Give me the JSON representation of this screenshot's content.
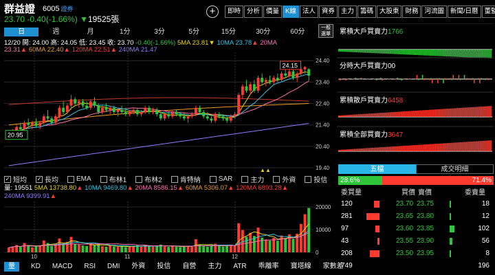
{
  "header": {
    "name": "群益證",
    "code": "6005",
    "code_tag": "證券",
    "price": "23.70",
    "change": "-0.40(-1.66%)",
    "volume": "19525張",
    "plus_label": "+"
  },
  "topnav": [
    "即時",
    "分析",
    "價量",
    "K線",
    "法人",
    "資券",
    "主力",
    "籌碼",
    "大股東",
    "財務",
    "河流圖",
    "新聞/日曆",
    "董監/公司"
  ],
  "topnav_active": "K線",
  "periods": [
    "日",
    "週",
    "月",
    "1分",
    "3分",
    "5分",
    "15分",
    "30分",
    "60分"
  ],
  "periods_active": "日",
  "side_button": "一般\n選單",
  "kline_info": {
    "date": "12/20",
    "open": "開: 24.00",
    "high": "高: 24.05",
    "low": "低: 23.45",
    "close": "收: 23.70",
    "change": "-0.40(-1.66%)",
    "ma5": "5MA 23.81",
    "ma10": "10MA 23.78",
    "ma20_label": "20MA",
    "ma20": "23.31",
    "ma60": "60MA 22.40",
    "ma120": "120MA 22.51",
    "ma240": "240MA 21.47"
  },
  "price_axis": [
    "24.40",
    "23.40",
    "22.40",
    "21.40",
    "20.40",
    "19.40"
  ],
  "price_callouts": {
    "high": "24.15",
    "low": "20.95"
  },
  "toggles": [
    {
      "label": "短均",
      "checked": true
    },
    {
      "label": "長均",
      "checked": true
    },
    {
      "label": "EMA",
      "checked": false
    },
    {
      "label": "布林1",
      "checked": false
    },
    {
      "label": "布林2",
      "checked": false
    },
    {
      "label": "肯特納",
      "checked": false
    },
    {
      "label": "SAR",
      "checked": false
    },
    {
      "label": "主力",
      "checked": false
    },
    {
      "label": "外資",
      "checked": false
    },
    {
      "label": "投信",
      "checked": false
    }
  ],
  "volume_info": {
    "vol": "量: 19551",
    "ma5": "5MA 13738.80",
    "ma10": "10MA 9469.80",
    "ma20": "20MA 8586.15",
    "ma60": "60MA 5306.07",
    "ma120": "120MA 6893.28",
    "ma240": "240MA 9399.91"
  },
  "volume_axis": [
    "20000",
    "10000",
    "0"
  ],
  "month_labels": [
    "10",
    "11",
    "12"
  ],
  "bottom_tabs": [
    "量",
    "KD",
    "MACD",
    "RSI",
    "DMI",
    "外資",
    "投信",
    "自營",
    "主力",
    "ATR",
    "乖離率",
    "寶塔線",
    "家數差"
  ],
  "bottom_active": "量",
  "right_panels": [
    {
      "label": "累積大戶買賣力",
      "value": "1766",
      "color": "#2ec53a"
    },
    {
      "label": "分時大戶買賣力",
      "value": "00",
      "color": "#ffffff"
    },
    {
      "label": "累積散戶買賣力",
      "value": "6458",
      "color": "#ff3b30"
    },
    {
      "label": "累積全部買賣力",
      "value": "3647",
      "color": "#ff3b30"
    }
  ],
  "orderbook_tabs": [
    "五檔",
    "成交明細"
  ],
  "ratio": {
    "buy": "28.6%",
    "sell": "71.4%"
  },
  "orderbook_headers": {
    "buy_qty": "委買量",
    "buy_price": "買價",
    "sell_price": "賣價",
    "sell_qty": "委賣量"
  },
  "orderbook": [
    {
      "buy_qty": "120",
      "buy_price": "23.70",
      "sell_price": "23.75",
      "sell_qty": "18"
    },
    {
      "buy_qty": "281",
      "buy_price": "23.65",
      "sell_price": "23.80",
      "sell_qty": "12"
    },
    {
      "buy_qty": "97",
      "buy_price": "23.60",
      "sell_price": "23.85",
      "sell_qty": "102"
    },
    {
      "buy_qty": "43",
      "buy_price": "23.55",
      "sell_price": "23.90",
      "sell_qty": "56"
    },
    {
      "buy_qty": "208",
      "buy_price": "23.50",
      "sell_price": "23.95",
      "sell_qty": "8"
    }
  ],
  "orderbook_total": {
    "buy": "749",
    "sell": "196"
  },
  "colors": {
    "up": "#ff3b30",
    "down": "#2ec53a",
    "accent": "#1e8fd0",
    "cyan": "#29b6e6"
  },
  "chart_data": {
    "type": "candlestick",
    "ylim": [
      19.4,
      24.6
    ],
    "candles": [
      [
        20.8,
        21.0,
        20.7,
        20.95
      ],
      [
        20.95,
        21.2,
        20.9,
        21.1
      ],
      [
        21.1,
        21.4,
        21.0,
        21.3
      ],
      [
        21.3,
        21.5,
        21.1,
        21.2
      ],
      [
        21.2,
        21.6,
        21.1,
        21.5
      ],
      [
        21.5,
        21.7,
        21.3,
        21.4
      ],
      [
        21.4,
        21.6,
        21.2,
        21.5
      ],
      [
        21.5,
        21.7,
        21.3,
        21.35
      ],
      [
        21.35,
        21.6,
        21.2,
        21.5
      ],
      [
        21.5,
        21.9,
        21.4,
        21.8
      ],
      [
        21.8,
        22.1,
        21.6,
        21.7
      ],
      [
        21.7,
        21.8,
        21.4,
        21.5
      ],
      [
        21.5,
        21.9,
        21.4,
        21.8
      ],
      [
        21.8,
        22.3,
        21.7,
        22.2
      ],
      [
        22.2,
        22.5,
        21.9,
        22.0
      ],
      [
        22.0,
        22.4,
        21.9,
        22.3
      ],
      [
        22.3,
        22.8,
        22.1,
        22.6
      ],
      [
        22.6,
        22.7,
        22.3,
        22.4
      ],
      [
        22.4,
        22.6,
        22.2,
        22.5
      ],
      [
        22.5,
        22.6,
        22.2,
        22.3
      ],
      [
        22.3,
        22.5,
        22.1,
        22.2
      ],
      [
        22.2,
        22.6,
        22.1,
        22.5
      ],
      [
        22.5,
        22.7,
        22.2,
        22.3
      ],
      [
        22.3,
        22.4,
        21.9,
        22.0
      ],
      [
        22.0,
        22.3,
        21.9,
        22.2
      ],
      [
        22.2,
        22.4,
        22.0,
        22.1
      ],
      [
        22.1,
        22.3,
        21.9,
        22.2
      ],
      [
        22.2,
        22.3,
        21.9,
        22.0
      ],
      [
        22.0,
        22.2,
        21.8,
        22.1
      ],
      [
        22.1,
        22.3,
        21.9,
        22.0
      ],
      [
        22.0,
        22.2,
        21.8,
        21.9
      ],
      [
        21.9,
        22.1,
        21.8,
        22.0
      ],
      [
        22.0,
        22.2,
        21.9,
        22.1
      ],
      [
        22.1,
        22.2,
        21.8,
        21.9
      ],
      [
        21.9,
        22.1,
        21.8,
        22.0
      ],
      [
        22.0,
        22.3,
        21.9,
        22.2
      ],
      [
        22.2,
        22.3,
        21.9,
        22.0
      ],
      [
        22.0,
        22.2,
        21.9,
        22.1
      ],
      [
        22.1,
        22.2,
        21.8,
        21.9
      ],
      [
        21.9,
        22.0,
        21.6,
        21.7
      ],
      [
        21.7,
        22.0,
        21.6,
        21.9
      ],
      [
        21.9,
        22.0,
        21.7,
        21.8
      ],
      [
        21.8,
        22.1,
        21.7,
        22.0
      ],
      [
        22.0,
        22.1,
        21.8,
        21.9
      ],
      [
        21.9,
        22.0,
        21.7,
        21.8
      ],
      [
        21.8,
        22.0,
        21.6,
        21.7
      ],
      [
        21.7,
        21.9,
        21.5,
        21.8
      ],
      [
        21.8,
        22.0,
        21.7,
        21.9
      ],
      [
        21.9,
        22.3,
        21.8,
        22.2
      ],
      [
        22.2,
        22.3,
        21.9,
        22.0
      ],
      [
        22.0,
        22.1,
        21.7,
        21.8
      ],
      [
        21.8,
        22.0,
        21.6,
        21.7
      ],
      [
        21.7,
        21.8,
        21.5,
        21.6
      ],
      [
        21.6,
        22.0,
        21.5,
        21.9
      ],
      [
        21.9,
        22.0,
        21.7,
        21.8
      ],
      [
        21.8,
        21.9,
        21.6,
        21.7
      ],
      [
        21.7,
        21.8,
        21.5,
        21.6
      ],
      [
        21.6,
        21.9,
        21.5,
        21.8
      ],
      [
        21.8,
        22.0,
        21.7,
        21.9
      ],
      [
        21.9,
        22.9,
        21.9,
        22.8
      ],
      [
        22.8,
        23.3,
        22.6,
        23.2
      ],
      [
        23.2,
        23.5,
        22.9,
        23.0
      ],
      [
        23.0,
        23.4,
        22.8,
        23.3
      ],
      [
        23.3,
        23.5,
        22.9,
        23.0
      ],
      [
        23.0,
        23.7,
        22.9,
        23.6
      ],
      [
        23.6,
        23.8,
        23.3,
        23.4
      ],
      [
        23.4,
        23.6,
        23.2,
        23.5
      ],
      [
        23.5,
        23.7,
        23.3,
        23.4
      ],
      [
        23.4,
        23.7,
        23.3,
        23.6
      ],
      [
        23.6,
        23.8,
        23.4,
        23.5
      ],
      [
        23.5,
        23.9,
        23.4,
        23.8
      ],
      [
        23.8,
        24.0,
        23.6,
        23.7
      ],
      [
        23.7,
        24.0,
        23.6,
        23.9
      ],
      [
        23.9,
        24.0,
        23.5,
        23.6
      ],
      [
        23.6,
        23.9,
        23.4,
        23.8
      ],
      [
        23.8,
        24.1,
        23.7,
        24.0
      ],
      [
        24.0,
        24.15,
        23.8,
        24.1
      ],
      [
        24.0,
        24.05,
        23.45,
        23.7
      ]
    ],
    "volumes": [
      2100,
      2600,
      3200,
      2400,
      4100,
      2800,
      2200,
      2600,
      3000,
      5200,
      4100,
      2800,
      3600,
      6100,
      3900,
      4600,
      6800,
      3700,
      3400,
      3000,
      2800,
      3900,
      3200,
      3600,
      2700,
      2500,
      3100,
      2600,
      2400,
      2700,
      2300,
      2500,
      2800,
      3100,
      2600,
      3300,
      2700,
      2500,
      3000,
      3400,
      2600,
      2400,
      2900,
      2500,
      2300,
      2600,
      2900,
      2400,
      5800,
      3300,
      2700,
      2500,
      2900,
      3800,
      2800,
      2600,
      3000,
      3300,
      3100,
      12800,
      9800,
      6800,
      8600,
      7200,
      10900,
      6500,
      5700,
      5200,
      6400,
      5100,
      7400,
      6300,
      7900,
      6000,
      8200,
      12500,
      16800,
      19551
    ],
    "series_colors": {
      "ma5": "#e6d21a",
      "ma10": "#29c6e6",
      "ma20": "#ff6fb2",
      "ma60": "#f09a20",
      "ma120": "#c0392b",
      "ma240": "#8f7bff"
    }
  }
}
